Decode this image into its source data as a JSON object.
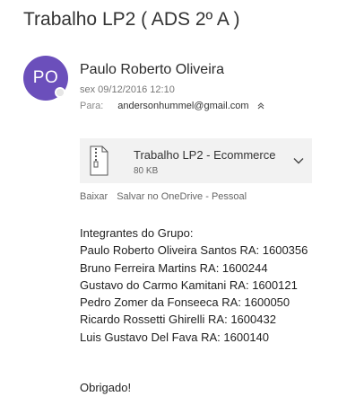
{
  "email": {
    "subject": "Trabalho LP2 ( ADS 2º A )",
    "sender_initials": "PO",
    "sender_name": "Paulo Roberto Oliveira",
    "date": "sex 09/12/2016 12:10",
    "to_label": "Para:",
    "to_address": "andersonhummel@gmail.com",
    "avatar_color": "#6b4fbb"
  },
  "attachment": {
    "name": "Trabalho LP2 - Ecommerce",
    "size": "80 KB",
    "icon": "zip-file-icon",
    "actions": [
      "Baixar",
      "Salvar no OneDrive - Pessoal"
    ]
  },
  "body": {
    "lines": [
      "Integrantes do Grupo:",
      "Paulo Roberto Oliveira Santos RA: 1600356",
      "Bruno Ferreira Martins RA: 1600244",
      "Gustavo do Carmo Kamitani RA: 1600121",
      "Pedro Zomer da Fonseeca RA: 1600050",
      "Ricardo Rossetti Ghirelli RA: 1600432",
      "Luis Gustavo Del Fava RA: 1600140"
    ],
    "closing": "Obrigado!"
  }
}
